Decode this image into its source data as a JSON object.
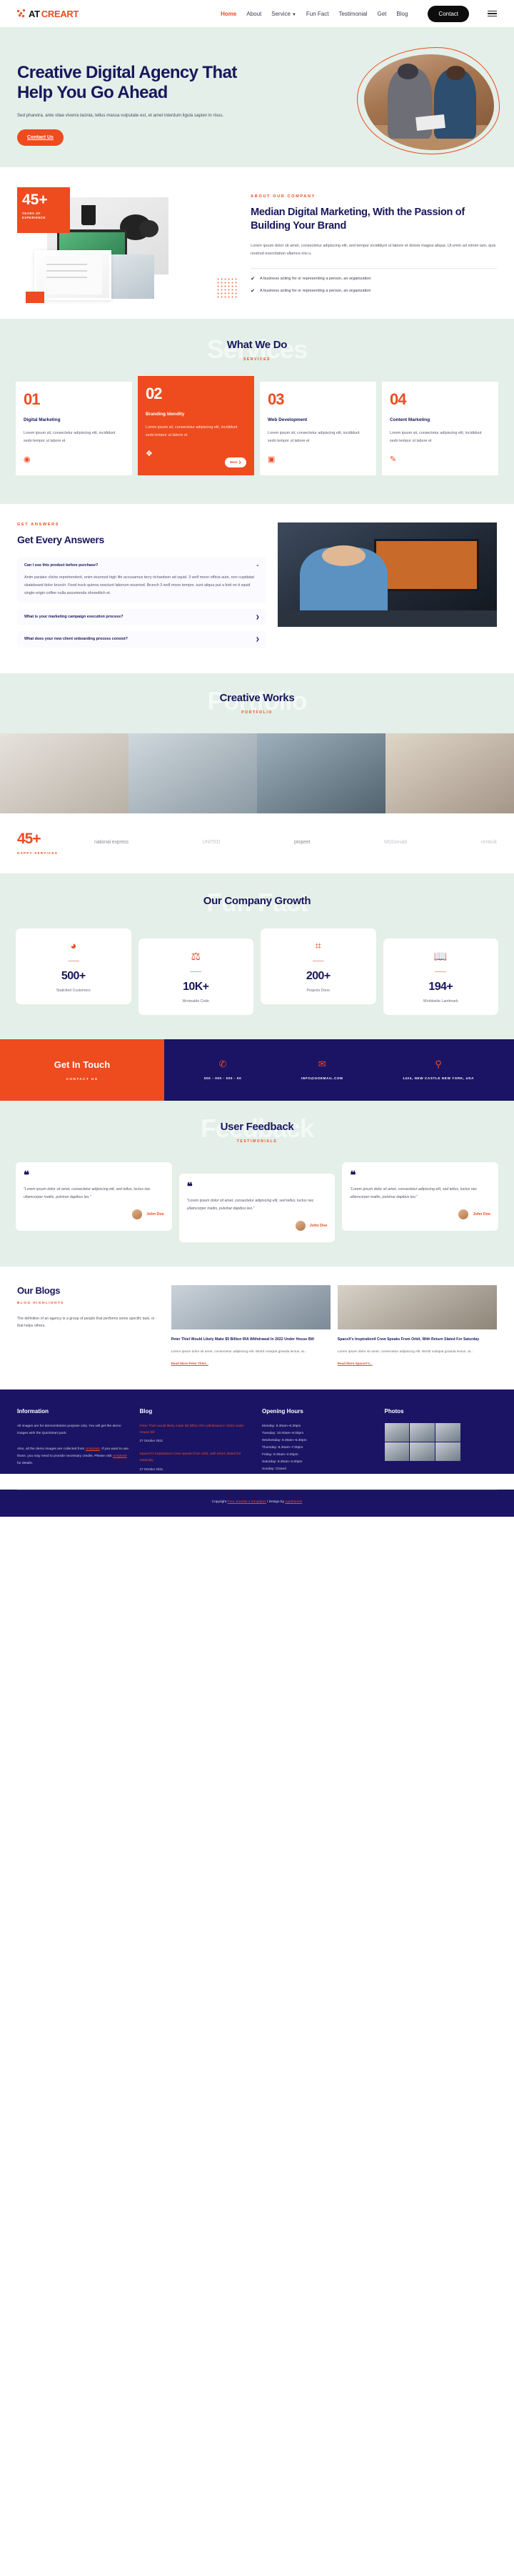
{
  "header": {
    "logo_at": "AT",
    "logo_creart": "CREART",
    "nav": [
      {
        "label": "Home",
        "active": true
      },
      {
        "label": "About",
        "active": false
      },
      {
        "label": "Service",
        "active": false,
        "dropdown": true
      },
      {
        "label": "Fun Fact",
        "active": false
      },
      {
        "label": "Testimonial",
        "active": false
      },
      {
        "label": "Get",
        "active": false
      },
      {
        "label": "Blog",
        "active": false
      }
    ],
    "contact_button": "Contact",
    "menu_icon": "hamburger-icon"
  },
  "hero": {
    "title": "Creative Digital Agency That Help You Go Ahead",
    "paragraph": "Sed pharetra, ante vitae viverra lacinia, tellus massa vulputate est, et amet interdum ligula sapien in risus.",
    "cta": "Contact Us"
  },
  "about": {
    "badge_number": "45+",
    "badge_label": "YEARS OF EXPERIENCE",
    "eyebrow": "ABOUT OUR COMPANY",
    "title": "Median Digital Marketing, With the Passion of Building Your Brand",
    "paragraph": "Lorem ipsum dolor sit amet, consectetur adipiscing elit, sed tempor incididunt ut labore et dolore magna aliqua. Ut enim ad minim iam, quis nostrud exercitation ullamco nisi u.",
    "checks": [
      "A business acting for or representing a person, an organization",
      "A business acting for or representing a person, an organization"
    ]
  },
  "services": {
    "ghost": "Services",
    "title": "What We Do",
    "subtitle": "SERVICES",
    "more_label": "More  ❯",
    "cards": [
      {
        "num": "01",
        "title": "Digital Marketing",
        "text": "Lorem ipsum sit, consectetur adipiscing elit, incididunt sedo tempor ut labore et",
        "icon": "marketing-icon"
      },
      {
        "num": "02",
        "title": "Branding Idendity",
        "text": "Lorem ipsum sit, consectetur adipiscing elit, incididunt sedo tempor ut labore et",
        "icon": "branding-icon"
      },
      {
        "num": "03",
        "title": "Web Development",
        "text": "Lorem ipsum sit, consectetur adipiscing elit, incididunt sedo tempor ut labore et",
        "icon": "web-icon"
      },
      {
        "num": "04",
        "title": "Content Marketing",
        "text": "Lorem ipsum sit, consectetur adipiscing elit, incididunt sedo tempor ut labore et",
        "icon": "content-icon"
      }
    ]
  },
  "faq": {
    "eyebrow": "GET ANSWERS",
    "title": "Get Every Answers",
    "items": [
      {
        "question": "Can I use this product before purchase?",
        "answer": "Anim pariatur cliche reprehenderit, enim eiusmod high life accusamus terry richardson ad squid. 3 wolf moon officia aute, non cupidatat skateboard dolor brunch. Food truck quinoa nesciunt laborum eiusmod. Brunch 3 wolf moon tempor, sunt aliqua put a bird on it squid single-origin coffee nulla assumenda shoreditch et.",
        "open": true
      },
      {
        "question": "What is your marketing campaign execution process?",
        "answer": "",
        "open": false
      },
      {
        "question": "What does your new client onboarding process consist?",
        "answer": "",
        "open": false
      }
    ]
  },
  "portfolio": {
    "ghost": "Portfolio",
    "title": "Creative Works",
    "subtitle": "PORTFOLIO"
  },
  "clients": {
    "number": "45+",
    "label": "HAPPY SERVICES",
    "logos": [
      "national express",
      "UNITED",
      "propeet",
      "MGDonald",
      "centrick"
    ]
  },
  "funfact": {
    "ghost": "Fun Fact",
    "title": "Our Company Growth",
    "stats": [
      {
        "icon": "pie-chart-icon",
        "number": "500+",
        "label": "Staticfied Customers"
      },
      {
        "icon": "scales-icon",
        "number": "10K+",
        "label": "Wroteable Code"
      },
      {
        "icon": "nodes-icon",
        "number": "200+",
        "label": "Projects Done"
      },
      {
        "icon": "book-person-icon",
        "number": "194+",
        "label": "Worldwide Landmark"
      }
    ]
  },
  "contact_strip": {
    "title": "Get In Touch",
    "subtitle": "CONTACT US",
    "items": [
      {
        "icon": "phone-icon",
        "text": "000 - 000 - 000 - 00"
      },
      {
        "icon": "mail-icon",
        "text": "INFO@GOEMAIL.COM"
      },
      {
        "icon": "location-icon",
        "text": "1424, NEW CASTLE NEW YORK, USA"
      }
    ]
  },
  "testimonial": {
    "ghost": "Feedback",
    "title": "User Feedback",
    "subtitle": "TESTIMONIALS",
    "cards": [
      {
        "quote": "\"Lorem ipsum dolor sit amet, consectetur adipiscing elit, sed tellus, luctus nec ullamcorper mattis, pulvinar dapibus leo.\"",
        "name": "John Doe"
      },
      {
        "quote": "\"Lorem ipsum dolor sit amet, consectetur adipiscing elit, sed tellus, luctus nec ullamcorper mattis, pulvinar dapibus leo.\"",
        "name": "John Doe"
      },
      {
        "quote": "\"Lorem ipsum dolor sit amet, consectetur adipiscing elit, sed tellus, luctus nec ullamcorper mattis, pulvinar dapibus leo.\"",
        "name": "John Doe"
      }
    ]
  },
  "blog": {
    "title": "Our Blogs",
    "subtitle": "BLOG HIGHLIGHTS",
    "intro": "The definition of an agency is a group of people that performs some specific task, or that helps others.",
    "posts": [
      {
        "title": "Peter Thiel Would Likely Make $5 Billion IRA Withdrawal In 2022 Under House Bill",
        "text": "Lorem ipsum dolor sit amet, consectetur adipiscing elit. World volutpat gravida lectus, at...",
        "link": "Read More Peter Thiel..."
      },
      {
        "title": "SpaceX's Inspiration4 Crew Speaks From Orbit, With Return Slated For Saturday",
        "text": "Lorem ipsum dolor sit amet, consectetur adipiscing elit. World volutpat gravida lectus, at...",
        "link": "Read More SpaceX's..."
      }
    ]
  },
  "footer": {
    "information": {
      "heading": "Information",
      "p1": "All images are for demonstration purpose only. You will get the demo images with the QuickStart pack.",
      "p2_a": "Also, all the demo images are collected from ",
      "p2_link1": "Unsplash",
      "p2_b": ". If you want to use those, you may need to provide necessary credits. Please visit ",
      "p2_link2": "Unsplash",
      "p2_c": " for details."
    },
    "blog": {
      "heading": "Blog",
      "posts": [
        {
          "title": "Peter Thiel would likely make $5 billion IRA withdrawal in 2022 under House bill",
          "date": "27 October 2021"
        },
        {
          "title": "SpaceX's Inspiration4 crew speaks from orbit, with return slated for Saturday",
          "date": "27 October 2021"
        }
      ]
    },
    "opening": {
      "heading": "Opening Hours",
      "rows": [
        "Monday: 8.30am–6.30pm",
        "Tuesday: 10.00am–8.00pm",
        "Wednesday: 8.30am–6.30pm",
        "Thursday: 8.30am–7.00pm",
        "Friday: 8.30am–3.00pm",
        "Saturday: 8.30am–2.00pm",
        "Sunday: Closed"
      ]
    },
    "photos": {
      "heading": "Photos"
    },
    "copyright_pre": "Copyright ",
    "copyright_link1": "Free Joomla! 4 templates",
    "copyright_mid": " / Design by ",
    "copyright_link2": "Agethemes"
  },
  "colors": {
    "accent": "#ee4b1f",
    "navy": "#1b1464",
    "mint": "#e3efe8"
  }
}
